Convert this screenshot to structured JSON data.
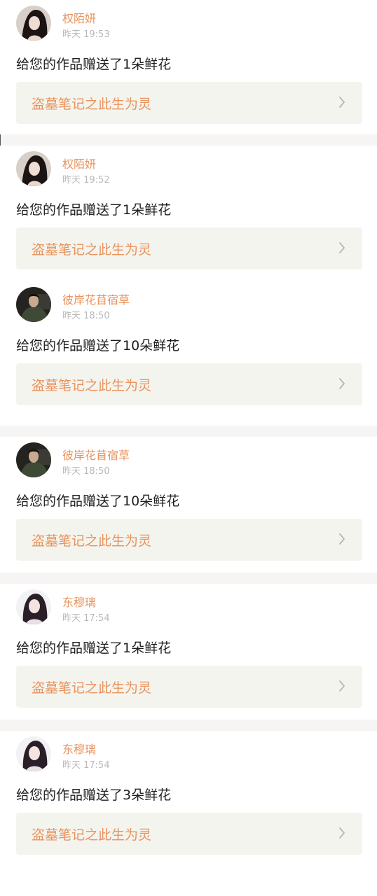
{
  "notifications": [
    {
      "user": "权陌妍",
      "time": "昨天 19:53",
      "message": "给您的作品赠送了1朵鲜花",
      "work": "盗墓笔记之此生为灵",
      "avatar": "woman-dark-hair-avatar"
    },
    {
      "user": "权陌妍",
      "time": "昨天 19:52",
      "message": "给您的作品赠送了1朵鲜花",
      "work": "盗墓笔记之此生为灵",
      "avatar": "woman-dark-hair-avatar"
    },
    {
      "user": "彼岸花苜宿草",
      "time": "昨天 18:50",
      "message": "给您的作品赠送了10朵鲜花",
      "work": "盗墓笔记之此生为灵",
      "avatar": "man-dark-jacket-avatar"
    },
    {
      "user": "彼岸花苜宿草",
      "time": "昨天 18:50",
      "message": "给您的作品赠送了10朵鲜花",
      "work": "盗墓笔记之此生为灵",
      "avatar": "man-dark-jacket-avatar"
    },
    {
      "user": "东穆璃",
      "time": "昨天 17:54",
      "message": "给您的作品赠送了1朵鲜花",
      "work": "盗墓笔记之此生为灵",
      "avatar": "woman-long-hair-avatar"
    },
    {
      "user": "东穆璃",
      "time": "昨天 17:54",
      "message": "给您的作品赠送了3朵鲜花",
      "work": "盗墓笔记之此生为灵",
      "avatar": "woman-long-hair-avatar"
    }
  ],
  "colors": {
    "accent": "#e8935e",
    "time": "#b9b9b9",
    "link_bg": "#f4f4ee",
    "divider": "#f6f5f4"
  }
}
